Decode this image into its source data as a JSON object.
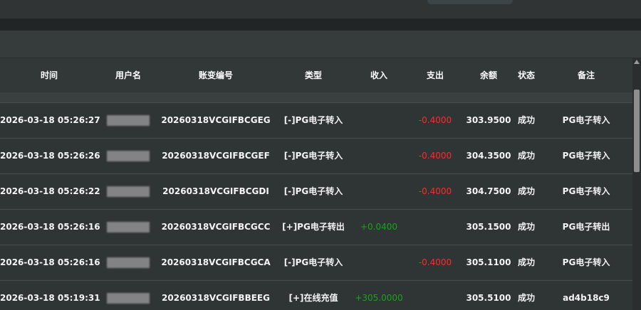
{
  "table": {
    "headers": [
      "时间",
      "用户名",
      "账变编号",
      "类型",
      "收入",
      "支出",
      "余额",
      "状态",
      "备注"
    ],
    "rows": [
      {
        "time": "2026-03-18 05:26:27",
        "id": "20260318VCGIFBCGEG",
        "type": "[-]PG电子转入",
        "income": "",
        "expense": "-0.4000",
        "balance": "303.9500",
        "status": "成功",
        "note": "PG电子转入"
      },
      {
        "time": "2026-03-18 05:26:26",
        "id": "20260318VCGIFBCGEF",
        "type": "[-]PG电子转入",
        "income": "",
        "expense": "-0.4000",
        "balance": "304.3500",
        "status": "成功",
        "note": "PG电子转入"
      },
      {
        "time": "2026-03-18 05:26:22",
        "id": "20260318VCGIFBCGDI",
        "type": "[-]PG电子转入",
        "income": "",
        "expense": "-0.4000",
        "balance": "304.7500",
        "status": "成功",
        "note": "PG电子转入"
      },
      {
        "time": "2026-03-18 05:26:16",
        "id": "20260318VCGIFBCGCC",
        "type": "[+]PG电子转出",
        "income": "+0.0400",
        "expense": "",
        "balance": "305.1500",
        "status": "成功",
        "note": "PG电子转出"
      },
      {
        "time": "2026-03-18 05:26:16",
        "id": "20260318VCGIFBCGCA",
        "type": "[-]PG电子转入",
        "income": "",
        "expense": "-0.4000",
        "balance": "305.1100",
        "status": "成功",
        "note": "PG电子转入"
      },
      {
        "time": "2026-03-18 05:19:31",
        "id": "20260318VCGIFBBEEG",
        "type": "[+]在线充值",
        "income": "+305.0000",
        "expense": "",
        "balance": "305.5100",
        "status": "成功",
        "note": "ad4b18c9"
      }
    ]
  },
  "colors": {
    "negative": "#ff2a2a",
    "positive": "#1aa31a",
    "background": "#2f3435"
  },
  "icons": {
    "scroll_up": "caret-up-icon"
  }
}
